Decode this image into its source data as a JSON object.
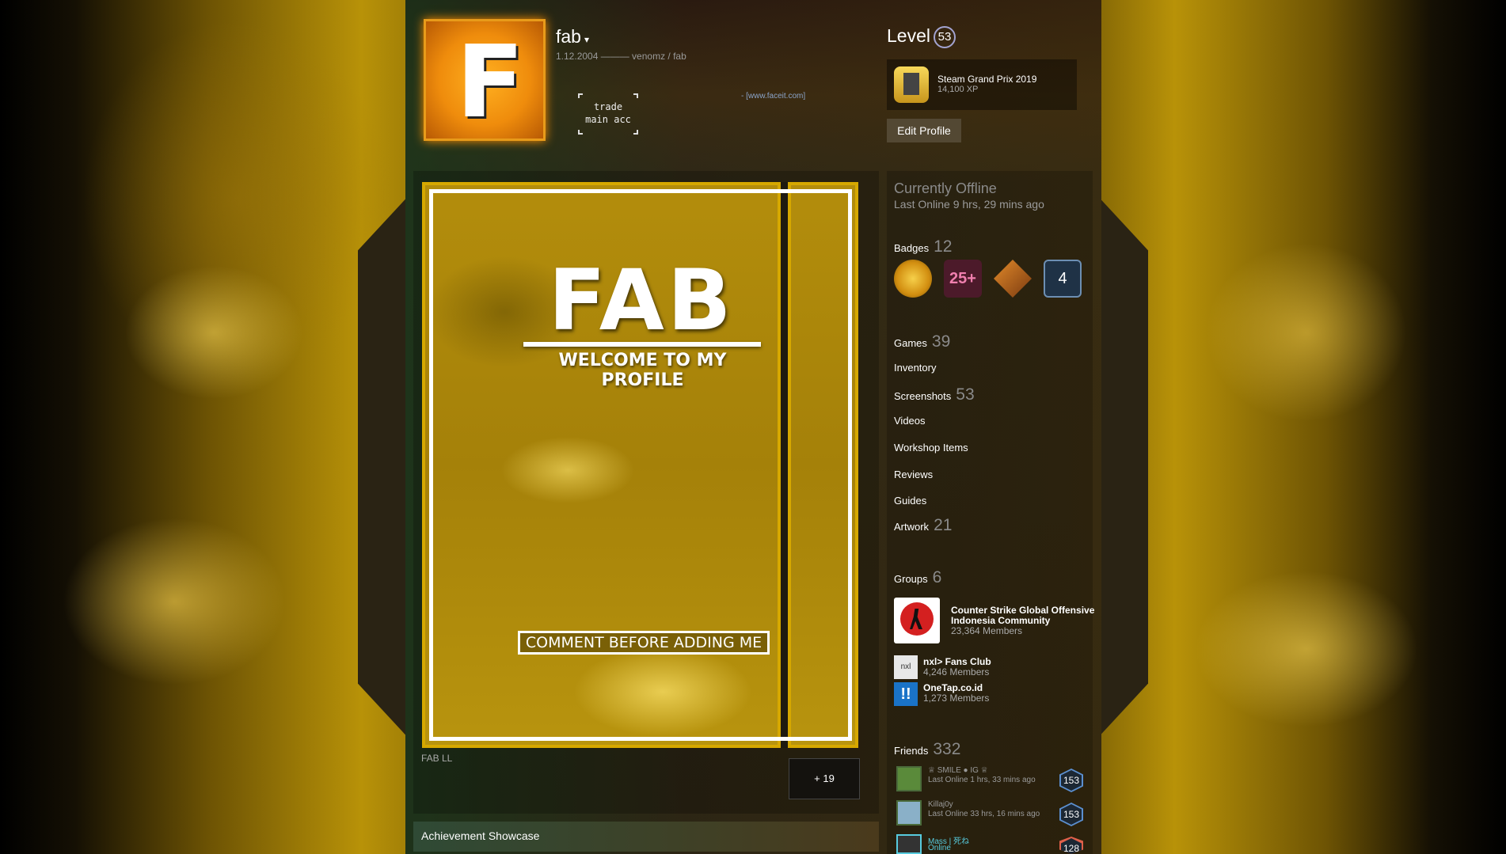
{
  "profile": {
    "name": "fab",
    "caret": "▾",
    "sub": "1.12.2004 ——— venomz / fab",
    "avatar_letter": "F",
    "summary_line1": "trade",
    "summary_line2": "main acc",
    "faceit": "- [www.faceit.com]"
  },
  "level": {
    "label": "Level",
    "value": "53"
  },
  "featured_badge": {
    "name": "Steam Grand Prix 2019",
    "xp": "14,100 XP"
  },
  "edit_label": "Edit Profile",
  "artwork": {
    "title": "FAB",
    "subtitle": "WELCOME TO MY PROFILE",
    "comment": "COMMENT BEFORE ADDING ME",
    "caption": "FAB LL",
    "more": "+ 19"
  },
  "achievement_label": "Achievement Showcase",
  "status": {
    "state": "Currently Offline",
    "last": "Last Online 9 hrs, 29 mins ago"
  },
  "badges": {
    "label": "Badges",
    "count": "12",
    "b2": "25+",
    "b4": "4"
  },
  "stats": [
    {
      "label": "Games",
      "count": "39"
    },
    {
      "label": "Inventory",
      "count": ""
    },
    {
      "label": "Screenshots",
      "count": "53"
    },
    {
      "label": "Videos",
      "count": ""
    },
    {
      "label": "Workshop Items",
      "count": ""
    },
    {
      "label": "Reviews",
      "count": ""
    },
    {
      "label": "Guides",
      "count": ""
    },
    {
      "label": "Artwork",
      "count": "21"
    }
  ],
  "groups": {
    "label": "Groups",
    "count": "6",
    "items": [
      {
        "name_line1": "Counter Strike Global Offensive",
        "name_line2": "Indonesia Community",
        "members": "23,364 Members"
      },
      {
        "name": "nxl> Fans Club",
        "members": "4,246 Members",
        "icon": "nxl"
      },
      {
        "name": "OneTap.co.id",
        "members": "1,273 Members",
        "icon": "!!"
      }
    ]
  },
  "friends": {
    "label": "Friends",
    "count": "332",
    "items": [
      {
        "name": "♕ SMILE ● IG ♕",
        "status": "Last Online 1 hrs, 33 mins ago",
        "level": "153"
      },
      {
        "name": "Killaj0y",
        "status": "Last Online 33 hrs, 16 mins ago",
        "level": "153"
      },
      {
        "name": "Mass | 死ね",
        "status": "Online",
        "level": "128"
      }
    ]
  },
  "colors": {
    "accent": "#e89b1a",
    "online": "#57cbde"
  }
}
